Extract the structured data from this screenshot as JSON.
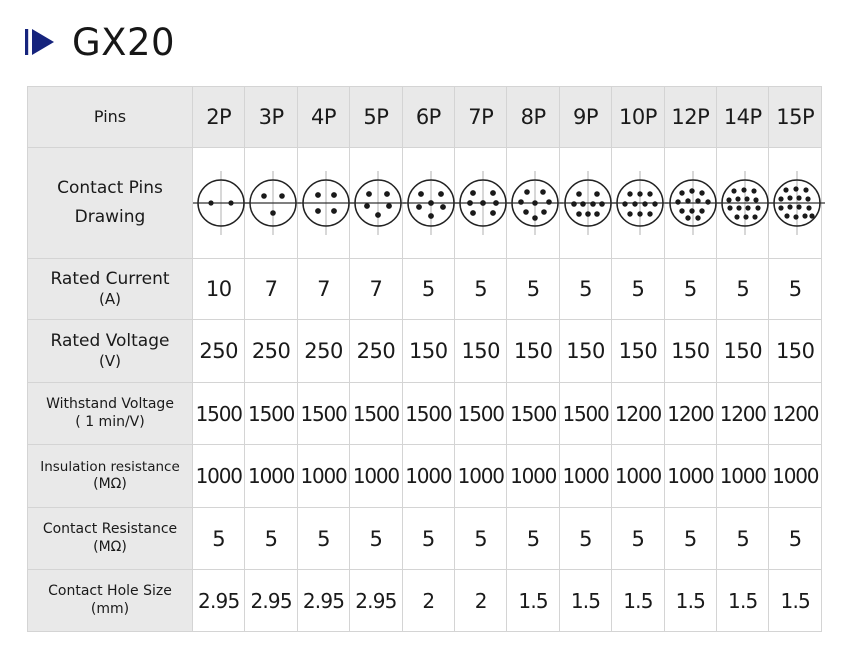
{
  "title": {
    "text": "GX20",
    "logo_icon": "play-triangle-icon",
    "logo_color": "#16247d"
  },
  "table": {
    "header_label": "Pins",
    "columns": [
      "2P",
      "3P",
      "4P",
      "5P",
      "6P",
      "7P",
      "8P",
      "9P",
      "10P",
      "12P",
      "14P",
      "15P"
    ],
    "drawing_row": {
      "label_line1": "Contact Pins",
      "label_line2": "Drawing"
    },
    "rows": [
      {
        "label_line1": "Rated Current",
        "label_line2": "(A)",
        "values": [
          "10",
          "7",
          "7",
          "7",
          "5",
          "5",
          "5",
          "5",
          "5",
          "5",
          "5",
          "5"
        ]
      },
      {
        "label_line1": "Rated Voltage",
        "label_line2": "(V)",
        "values": [
          "250",
          "250",
          "250",
          "250",
          "150",
          "150",
          "150",
          "150",
          "150",
          "150",
          "150",
          "150"
        ]
      },
      {
        "label_line1": "Withstand Voltage",
        "label_line2": "( 1 min/V)",
        "values": [
          "1500",
          "1500",
          "1500",
          "1500",
          "1500",
          "1500",
          "1500",
          "1500",
          "1200",
          "1200",
          "1200",
          "1200"
        ]
      },
      {
        "label_line1": "Insulation resistance",
        "label_line2": "(MΩ)",
        "values": [
          "1000",
          "1000",
          "1000",
          "1000",
          "1000",
          "1000",
          "1000",
          "1000",
          "1000",
          "1000",
          "1000",
          "1000"
        ]
      },
      {
        "label_line1": "Contact Resistance",
        "label_line2": "(MΩ)",
        "values": [
          "5",
          "5",
          "5",
          "5",
          "5",
          "5",
          "5",
          "5",
          "5",
          "5",
          "5",
          "5"
        ]
      },
      {
        "label_line1": "Contact Hole Size",
        "label_line2": "(mm)",
        "values": [
          "2.95",
          "2.95",
          "2.95",
          "2.95",
          "2",
          "2",
          "1.5",
          "1.5",
          "1.5",
          "1.5",
          "1.5",
          "1.5"
        ]
      }
    ],
    "pin_layouts": [
      {
        "name": "2P",
        "radius": 23,
        "pin_r": 2.6,
        "pins": [
          [
            -10,
            0
          ],
          [
            10,
            0
          ]
        ]
      },
      {
        "name": "3P",
        "radius": 23,
        "pin_r": 2.8,
        "pins": [
          [
            -9,
            -7
          ],
          [
            9,
            -7
          ],
          [
            0,
            10
          ]
        ]
      },
      {
        "name": "4P",
        "radius": 23,
        "pin_r": 2.9,
        "pins": [
          [
            -8,
            -8
          ],
          [
            8,
            -8
          ],
          [
            -8,
            8
          ],
          [
            8,
            8
          ]
        ]
      },
      {
        "name": "5P",
        "radius": 23,
        "pin_r": 2.9,
        "pins": [
          [
            -9,
            -9
          ],
          [
            9,
            -9
          ],
          [
            -11,
            3
          ],
          [
            11,
            3
          ],
          [
            0,
            12
          ]
        ]
      },
      {
        "name": "6P",
        "radius": 23,
        "pin_r": 2.9,
        "pins": [
          [
            -10,
            -9
          ],
          [
            10,
            -9
          ],
          [
            0,
            0
          ],
          [
            -12,
            4
          ],
          [
            12,
            4
          ],
          [
            0,
            13
          ]
        ]
      },
      {
        "name": "7P",
        "radius": 23,
        "pin_r": 2.9,
        "pins": [
          [
            -10,
            -10
          ],
          [
            10,
            -10
          ],
          [
            -13,
            0
          ],
          [
            13,
            0
          ],
          [
            -10,
            10
          ],
          [
            10,
            10
          ],
          [
            0,
            0
          ]
        ]
      },
      {
        "name": "8P",
        "radius": 23,
        "pin_r": 2.8,
        "pins": [
          [
            -8,
            -11
          ],
          [
            8,
            -11
          ],
          [
            -14,
            -1
          ],
          [
            14,
            -1
          ],
          [
            -9,
            9
          ],
          [
            9,
            9
          ],
          [
            0,
            15
          ],
          [
            0,
            0
          ]
        ]
      },
      {
        "name": "9P",
        "radius": 23,
        "pin_r": 2.8,
        "pins": [
          [
            -9,
            -9
          ],
          [
            9,
            -9
          ],
          [
            -14,
            1
          ],
          [
            -5,
            1
          ],
          [
            5,
            1
          ],
          [
            14,
            1
          ],
          [
            -9,
            11
          ],
          [
            0,
            11
          ],
          [
            9,
            11
          ]
        ]
      },
      {
        "name": "10P",
        "radius": 23,
        "pin_r": 2.7,
        "pins": [
          [
            -10,
            -9
          ],
          [
            0,
            -9
          ],
          [
            10,
            -9
          ],
          [
            -15,
            1
          ],
          [
            -5,
            1
          ],
          [
            5,
            1
          ],
          [
            15,
            1
          ],
          [
            -10,
            11
          ],
          [
            0,
            11
          ],
          [
            10,
            11
          ]
        ]
      },
      {
        "name": "12P",
        "radius": 23,
        "pin_r": 2.7,
        "pins": [
          [
            -11,
            -10
          ],
          [
            -1,
            -12
          ],
          [
            9,
            -10
          ],
          [
            -15,
            -1
          ],
          [
            -5,
            -2
          ],
          [
            5,
            -2
          ],
          [
            15,
            -1
          ],
          [
            -11,
            8
          ],
          [
            -1,
            8
          ],
          [
            9,
            8
          ],
          [
            -5,
            15
          ],
          [
            5,
            15
          ]
        ]
      },
      {
        "name": "14P",
        "radius": 23,
        "pin_r": 2.6,
        "pins": [
          [
            -11,
            -12
          ],
          [
            -1,
            -13
          ],
          [
            9,
            -12
          ],
          [
            -16,
            -3
          ],
          [
            -7,
            -4
          ],
          [
            2,
            -4
          ],
          [
            11,
            -3
          ],
          [
            -15,
            5
          ],
          [
            -6,
            5
          ],
          [
            3,
            5
          ],
          [
            13,
            5
          ],
          [
            -8,
            14
          ],
          [
            1,
            14
          ],
          [
            10,
            14
          ]
        ]
      },
      {
        "name": "15P",
        "radius": 23,
        "pin_r": 2.6,
        "pins": [
          [
            -11,
            -13
          ],
          [
            -1,
            -14
          ],
          [
            9,
            -13
          ],
          [
            -16,
            -4
          ],
          [
            -7,
            -5
          ],
          [
            2,
            -5
          ],
          [
            11,
            -4
          ],
          [
            -16,
            5
          ],
          [
            -7,
            4
          ],
          [
            2,
            4
          ],
          [
            12,
            5
          ],
          [
            -10,
            13
          ],
          [
            -1,
            14
          ],
          [
            8,
            13
          ],
          [
            15,
            13
          ]
        ]
      }
    ]
  }
}
